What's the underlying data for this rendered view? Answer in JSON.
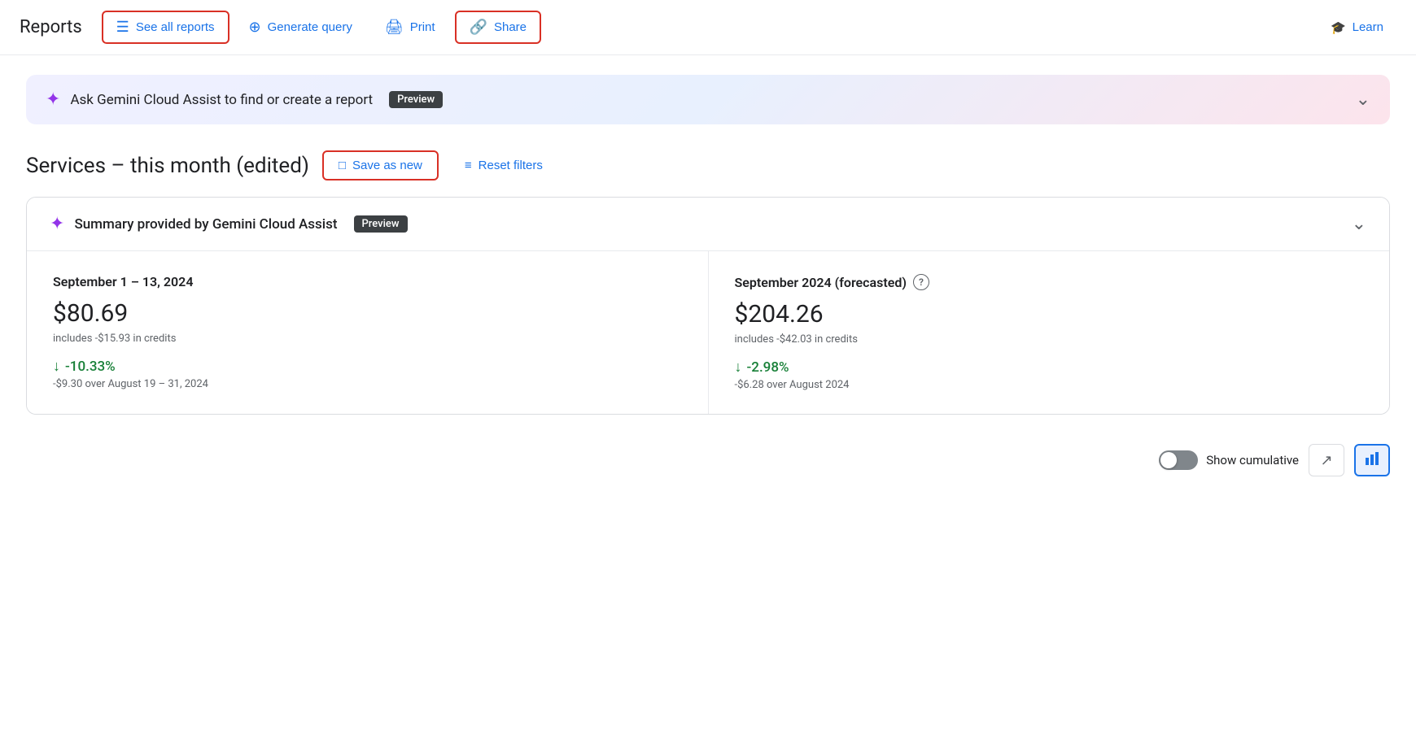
{
  "nav": {
    "title": "Reports",
    "see_all_reports": "See all reports",
    "generate_query": "Generate query",
    "print": "Print",
    "share": "Share",
    "learn": "Learn"
  },
  "gemini_banner": {
    "text": "Ask Gemini Cloud Assist to find or create a report",
    "badge": "Preview"
  },
  "report": {
    "title": "Services – this month (edited)",
    "save_as_new": "Save as new",
    "reset_filters": "Reset filters"
  },
  "summary_card": {
    "header": "Summary provided by Gemini Cloud Assist",
    "badge": "Preview",
    "col1": {
      "period": "September 1 – 13, 2024",
      "amount": "$80.69",
      "credits": "includes -$15.93 in credits",
      "change_pct": "-10.33%",
      "change_desc": "-$9.30 over August 19 – 31, 2024"
    },
    "col2": {
      "period": "September 2024 (forecasted)",
      "amount": "$204.26",
      "credits": "includes -$42.03 in credits",
      "change_pct": "-2.98%",
      "change_desc": "-$6.28 over August 2024"
    }
  },
  "bottom_controls": {
    "show_cumulative": "Show cumulative"
  }
}
